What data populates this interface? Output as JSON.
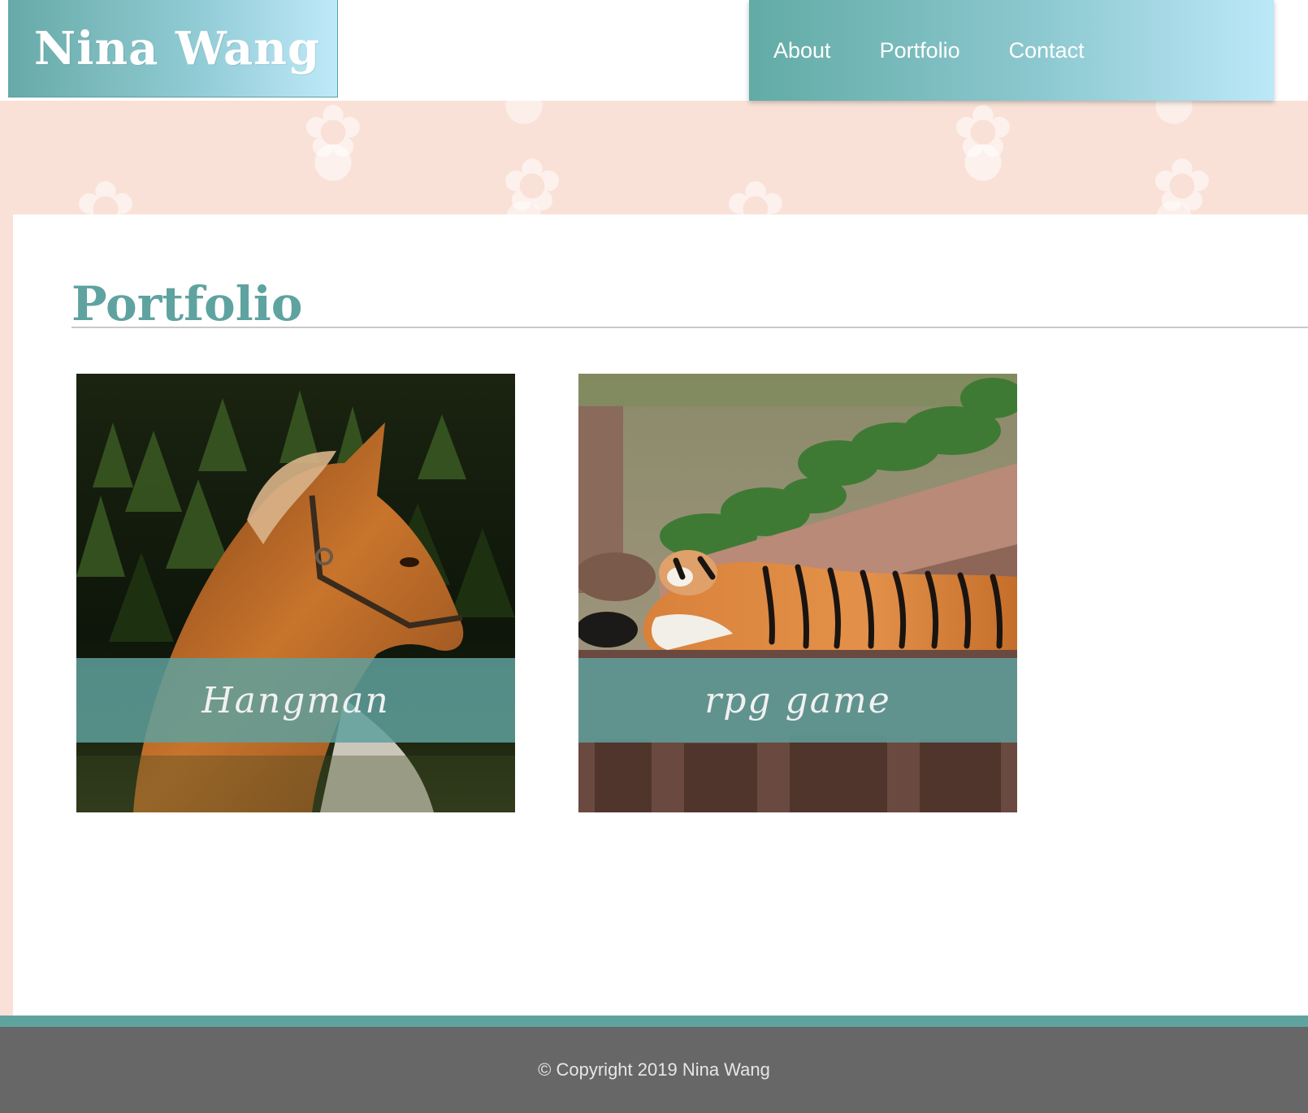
{
  "site": {
    "logo_text": "Nina Wang"
  },
  "nav": {
    "items": [
      {
        "label": "About"
      },
      {
        "label": "Portfolio"
      },
      {
        "label": "Contact"
      }
    ]
  },
  "main": {
    "title": "Portfolio",
    "projects": [
      {
        "caption": "Hangman",
        "image": "horse-photo"
      },
      {
        "caption": "rpg game",
        "image": "tiger-photo"
      }
    ]
  },
  "footer": {
    "copyright": "© Copyright 2019 Nina Wang"
  },
  "colors": {
    "accent_teal": "#5fa3a0",
    "background_peach": "#f9e1d7",
    "footer_gray": "#676767"
  }
}
